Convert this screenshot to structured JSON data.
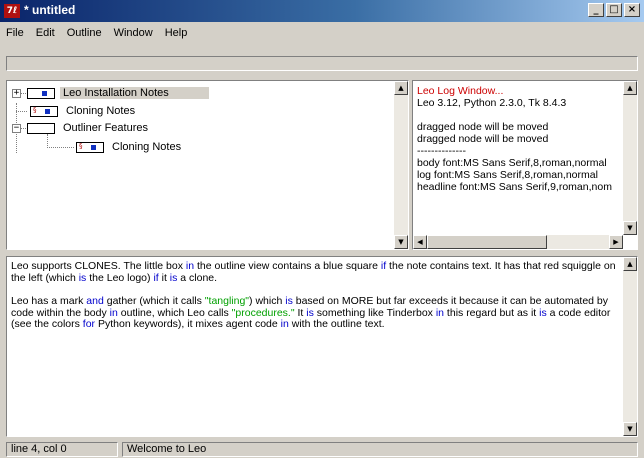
{
  "window": {
    "app_icon_text": "7ℓ",
    "title": "* untitled",
    "buttons": {
      "minimize": "_",
      "maximize": "□",
      "close": "×"
    }
  },
  "menu": [
    "File",
    "Edit",
    "Outline",
    "Window",
    "Help"
  ],
  "outline": {
    "nodes": [
      {
        "headline": "Leo Installation Notes",
        "expander": "+",
        "selected": true,
        "has_text": true,
        "cloned": false
      },
      {
        "headline": "Cloning Notes",
        "expander": "",
        "selected": false,
        "has_text": true,
        "cloned": true
      },
      {
        "headline": "Outliner Features",
        "expander": "−",
        "selected": false,
        "has_text": false,
        "cloned": false
      },
      {
        "headline": "Cloning Notes",
        "expander": "",
        "selected": false,
        "has_text": true,
        "cloned": true
      }
    ]
  },
  "log": {
    "title": "Leo Log Window...",
    "version": "Leo 3.12, Python 2.3.0, Tk 8.4.3",
    "messages": [
      "dragged node will be moved",
      "dragged node will be moved",
      "--------------",
      "body font:MS Sans Serif,8,roman,normal",
      "log font:MS Sans Serif,8,roman,normal",
      "headline font:MS Sans Serif,9,roman,nom"
    ]
  },
  "body": {
    "p1": [
      {
        "t": "Leo supports CLONES. The little box ",
        "c": ""
      },
      {
        "t": "in",
        "c": "kw"
      },
      {
        "t": " the outline view contains a blue square ",
        "c": ""
      },
      {
        "t": "if",
        "c": "kw"
      },
      {
        "t": " the note contains text. It has that red squiggle on the left (which ",
        "c": ""
      },
      {
        "t": "is",
        "c": "kw"
      },
      {
        "t": " the Leo logo) ",
        "c": ""
      },
      {
        "t": "if",
        "c": "kw"
      },
      {
        "t": " it ",
        "c": ""
      },
      {
        "t": "is",
        "c": "kw"
      },
      {
        "t": " a clone.",
        "c": ""
      }
    ],
    "p2": [
      {
        "t": "Leo has a mark ",
        "c": ""
      },
      {
        "t": "and",
        "c": "kw"
      },
      {
        "t": " gather (which it calls ",
        "c": ""
      },
      {
        "t": "\"tangling\"",
        "c": "str"
      },
      {
        "t": ") which ",
        "c": ""
      },
      {
        "t": "is",
        "c": "kw"
      },
      {
        "t": " based on MORE but far exceeds it because it can be automated by code within the body ",
        "c": ""
      },
      {
        "t": "in",
        "c": "kw"
      },
      {
        "t": " outline, which Leo calls ",
        "c": ""
      },
      {
        "t": "\"procedures.\"",
        "c": "str"
      },
      {
        "t": " It ",
        "c": ""
      },
      {
        "t": "is",
        "c": "kw"
      },
      {
        "t": " something like Tinderbox ",
        "c": ""
      },
      {
        "t": "in",
        "c": "kw"
      },
      {
        "t": " this regard but as it ",
        "c": ""
      },
      {
        "t": "is",
        "c": "kw"
      },
      {
        "t": " a code editor (see the colors ",
        "c": ""
      },
      {
        "t": "for",
        "c": "kw"
      },
      {
        "t": " Python keywords), it mixes agent code ",
        "c": ""
      },
      {
        "t": "in",
        "c": "kw"
      },
      {
        "t": " with the outline text.",
        "c": ""
      }
    ]
  },
  "status": {
    "position": "line 4, col 0",
    "message": "Welcome to Leo"
  },
  "colors": {
    "keyword": "#0000cc",
    "string": "#00a000",
    "log_title": "#cc0000",
    "title_bar": "#0a246a"
  }
}
